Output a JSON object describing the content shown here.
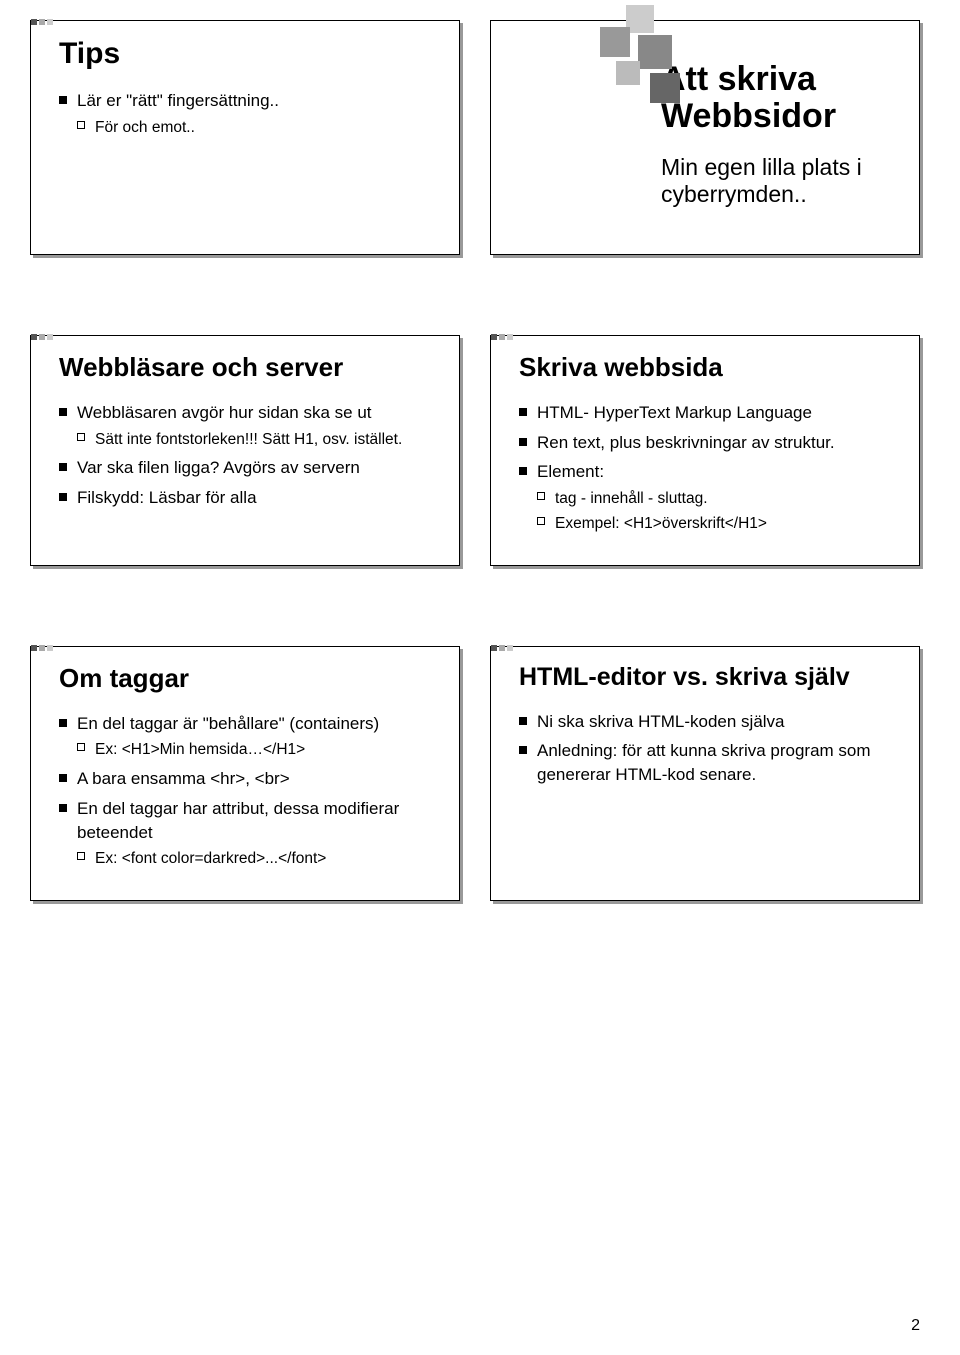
{
  "slides": {
    "tips": {
      "title": "Tips",
      "item1": "Lär er \"rätt\" fingersättning..",
      "sub1": "För och emot.."
    },
    "title": {
      "heading": "Att skriva Webbsidor",
      "subtitle": "Min egen lilla plats i cyberrymden.."
    },
    "server": {
      "title": "Webbläsare och server",
      "item1": "Webbläsaren avgör hur sidan ska se ut",
      "sub1": "Sätt inte fontstorleken!!! Sätt H1, osv. istället.",
      "item2": "Var ska filen ligga? Avgörs av servern",
      "item3": "Filskydd: Läsbar för alla"
    },
    "skriva": {
      "title": "Skriva webbsida",
      "item1": "HTML- HyperText Markup Language",
      "item2": "Ren text, plus beskrivningar av struktur.",
      "item3": "Element:",
      "sub1": "tag - innehåll - sluttag.",
      "sub2": "Exempel: <H1>överskrift</H1>"
    },
    "taggar": {
      "title": "Om taggar",
      "item1": "En del taggar är \"behållare\" (containers)",
      "sub1": "Ex: <H1>Min hemsida…</H1>",
      "item2": "A bara ensamma <hr>, <br>",
      "item3": "En del taggar har attribut, dessa modifierar beteendet",
      "sub2": "Ex: <font color=darkred>...</font>"
    },
    "editor": {
      "title": "HTML-editor vs. skriva själv",
      "item1": "Ni ska skriva HTML-koden själva",
      "item2": "Anledning: för att kunna skriva program som genererar HTML-kod senare."
    }
  },
  "page_number": "2"
}
